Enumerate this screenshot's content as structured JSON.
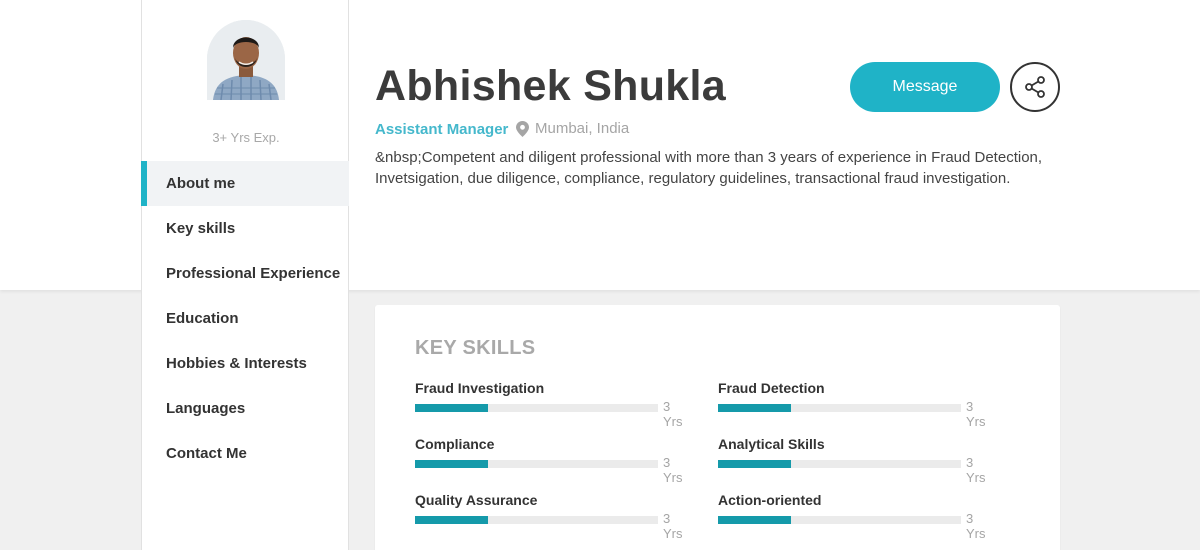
{
  "profile": {
    "name": "Abhishek Shukla",
    "experience": "3+ Yrs Exp.",
    "role": "Assistant Manager",
    "location": "Mumbai, India",
    "summary": "&nbsp;Competent and diligent professional with more than 3 years of experience in Fraud Detection, Invetsigation, due diligence, compliance, regulatory guidelines, transactional fraud investigation."
  },
  "actions": {
    "message_label": "Message",
    "share_icon": "share-icon"
  },
  "nav": {
    "items": [
      {
        "label": "About me",
        "active": true
      },
      {
        "label": "Key skills"
      },
      {
        "label": "Professional Experience"
      },
      {
        "label": "Education"
      },
      {
        "label": "Hobbies & Interests"
      },
      {
        "label": "Languages"
      },
      {
        "label": "Contact Me"
      }
    ]
  },
  "skills": {
    "title": "KEY SKILLS",
    "items": [
      {
        "name": "Fraud Investigation",
        "years": "3 Yrs",
        "level": 0.3
      },
      {
        "name": "Fraud Detection",
        "years": "3 Yrs",
        "level": 0.3
      },
      {
        "name": "Compliance",
        "years": "3 Yrs",
        "level": 0.3
      },
      {
        "name": "Analytical Skills",
        "years": "3 Yrs",
        "level": 0.3
      },
      {
        "name": "Quality Assurance",
        "years": "3 Yrs",
        "level": 0.3
      },
      {
        "name": "Action-oriented",
        "years": "3 Yrs",
        "level": 0.3
      }
    ]
  },
  "colors": {
    "accent": "#1fb3c7",
    "bar_fill": "#159aaa",
    "role_text": "#45b8cc"
  }
}
